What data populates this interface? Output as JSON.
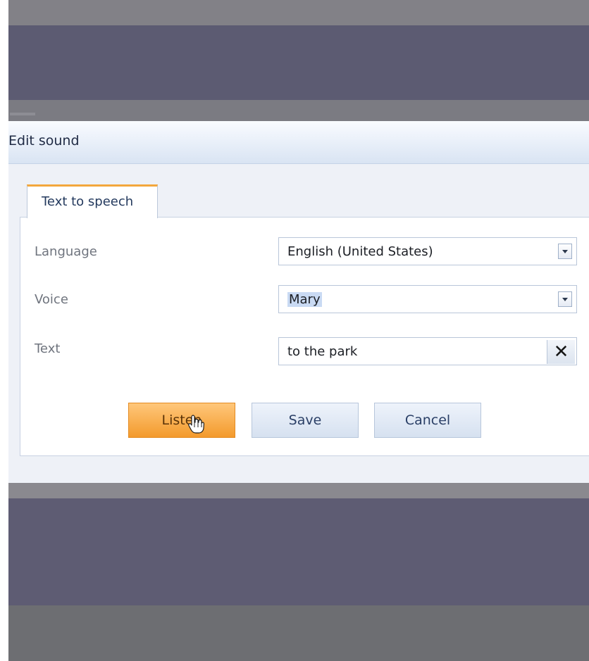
{
  "dialog": {
    "title": "Edit sound"
  },
  "tabs": [
    {
      "label": "Text to speech",
      "active": true
    }
  ],
  "form": {
    "language": {
      "label": "Language",
      "value": "English (United States)"
    },
    "voice": {
      "label": "Voice",
      "value": "Mary"
    },
    "text": {
      "label": "Text",
      "value": "to the park"
    }
  },
  "buttons": {
    "listen": "Listen",
    "save": "Save",
    "cancel": "Cancel"
  },
  "icons": {
    "clear": "close-icon",
    "dropdown": "chevron-down-icon",
    "cursor": "hand-cursor-icon"
  },
  "colors": {
    "accent_orange": "#f39a2c",
    "accent_blue": "#3e72b3",
    "background_dark": "#5c5b72"
  }
}
